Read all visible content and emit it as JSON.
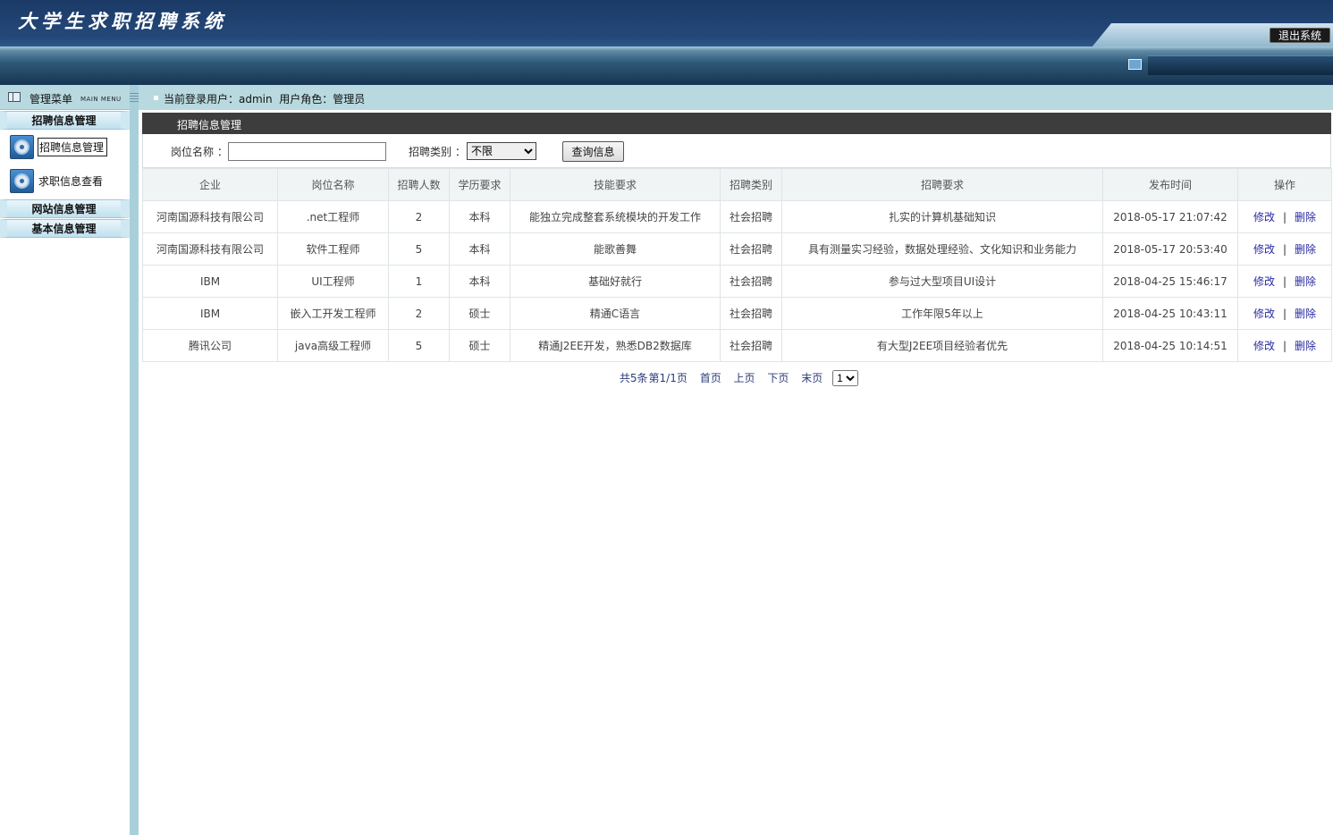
{
  "header": {
    "title": "大学生求职招聘系统",
    "logout_label": "退出系统"
  },
  "sidebar": {
    "menu_label": "管理菜单",
    "menu_sub": "MAIN MENU",
    "groups": [
      {
        "label": "招聘信息管理",
        "items": [
          {
            "label": "招聘信息管理",
            "active": true
          },
          {
            "label": "求职信息查看",
            "active": false
          }
        ]
      },
      {
        "label": "网站信息管理",
        "items": []
      },
      {
        "label": "基本信息管理",
        "items": []
      }
    ]
  },
  "topbar": {
    "info": "当前登录用户：admin  用户角色：管理员"
  },
  "main": {
    "panel_title": "招聘信息管理",
    "search": {
      "position_label": "岗位名称 ：",
      "position_value": "",
      "category_label": "招聘类别 ：",
      "category_selected": "不限",
      "submit_label": "查询信息"
    },
    "table": {
      "columns": [
        "企业",
        "岗位名称",
        "招聘人数",
        "学历要求",
        "技能要求",
        "招聘类别",
        "招聘要求",
        "发布时间",
        "操作"
      ],
      "rows": [
        {
          "company": "河南国源科技有限公司",
          "position": ".net工程师",
          "count": "2",
          "education": "本科",
          "skills": "能独立完成整套系统模块的开发工作",
          "category": "社会招聘",
          "requirements": "扎实的计算机基础知识",
          "time": "2018-05-17 21:07:42"
        },
        {
          "company": "河南国源科技有限公司",
          "position": "软件工程师",
          "count": "5",
          "education": "本科",
          "skills": "能歌善舞",
          "category": "社会招聘",
          "requirements": "具有测量实习经验，数据处理经验、文化知识和业务能力",
          "time": "2018-05-17 20:53:40"
        },
        {
          "company": "IBM",
          "position": "UI工程师",
          "count": "1",
          "education": "本科",
          "skills": "基础好就行",
          "category": "社会招聘",
          "requirements": "参与过大型项目UI设计",
          "time": "2018-04-25 15:46:17"
        },
        {
          "company": "IBM",
          "position": "嵌入工开发工程师",
          "count": "2",
          "education": "硕士",
          "skills": "精通C语言",
          "category": "社会招聘",
          "requirements": "工作年限5年以上",
          "time": "2018-04-25 10:43:11"
        },
        {
          "company": "腾讯公司",
          "position": "java高级工程师",
          "count": "5",
          "education": "硕士",
          "skills": "精通J2EE开发，熟悉DB2数据库",
          "category": "社会招聘",
          "requirements": "有大型J2EE项目经验者优先",
          "time": "2018-04-25 10:14:51"
        }
      ],
      "edit_label": "修改",
      "sep_label": "|",
      "delete_label": "删除"
    },
    "pager": {
      "total": "共5条",
      "page_info": "第1/1页",
      "first": "首页",
      "prev": "上页",
      "next": "下页",
      "last": "末页",
      "page_selected": "1"
    }
  }
}
